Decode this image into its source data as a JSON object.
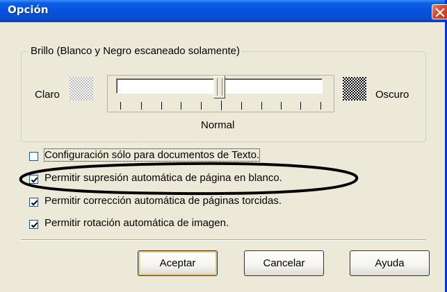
{
  "window": {
    "title": "Opción",
    "close_icon": "close-icon",
    "colors": {
      "titlebar": "#0553dd",
      "face": "#ece9d8",
      "close": "#d9482a",
      "annotation": "#000000"
    }
  },
  "brightness": {
    "group_label": "Brillo (Blanco y Negro escaneado solamente)",
    "light_label": "Claro",
    "dark_label": "Oscuro",
    "center_label": "Normal",
    "light_icon": "light-pattern-icon",
    "dark_icon": "dark-pattern-icon",
    "slider_value": 0.5
  },
  "options": [
    {
      "label": "Configuración sólo para documentos de Texto.",
      "checked": false
    },
    {
      "label": "Permitir supresión automática de página en blanco.",
      "checked": true
    },
    {
      "label": "Permitir corrección automática de páginas torcidas.",
      "checked": true
    },
    {
      "label": "Permitir rotación automática de imagen.",
      "checked": true
    }
  ],
  "buttons": {
    "ok": "Aceptar",
    "cancel": "Cancelar",
    "help": "Ayuda"
  }
}
